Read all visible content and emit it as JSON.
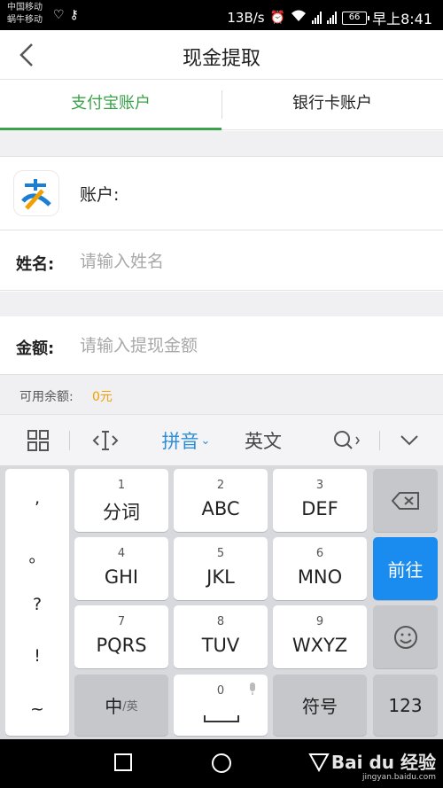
{
  "status_bar": {
    "carrier_1": "中国移动",
    "carrier_2": "蜗牛移动",
    "speed": "13B/s",
    "battery": "66",
    "time": "早上8:41"
  },
  "header": {
    "title": "现金提取"
  },
  "tabs": [
    {
      "label": "支付宝账户",
      "active": true
    },
    {
      "label": "银行卡账户",
      "active": false
    }
  ],
  "account": {
    "label": "账户:",
    "value": ""
  },
  "form": {
    "name_label": "姓名:",
    "name_placeholder": "请输入姓名",
    "amount_label": "金额:",
    "amount_placeholder": "请输入提现金额"
  },
  "balance": {
    "label": "可用余额:",
    "value": "0元"
  },
  "keyboard_toolbar": {
    "pinyin_label": "拼音",
    "english_label": "英文"
  },
  "keyboard": {
    "punctuation": [
      ",",
      "。",
      "?",
      "!",
      "~"
    ],
    "keys": [
      {
        "num": "1",
        "label": "分词"
      },
      {
        "num": "2",
        "label": "ABC"
      },
      {
        "num": "3",
        "label": "DEF"
      },
      {
        "num": "4",
        "label": "GHI"
      },
      {
        "num": "5",
        "label": "JKL"
      },
      {
        "num": "6",
        "label": "MNO"
      },
      {
        "num": "7",
        "label": "PQRS"
      },
      {
        "num": "8",
        "label": "TUV"
      },
      {
        "num": "9",
        "label": "WXYZ"
      }
    ],
    "go_label": "前往",
    "lang_label": "中",
    "lang_sub": "/英",
    "space_num": "0",
    "symbol_label": "符号",
    "num_label": "123"
  },
  "watermark": {
    "main": "Bai du 经验",
    "sub": "jingyan.baidu.com"
  },
  "colors": {
    "accent_green": "#39a34a",
    "ime_blue": "#2b8fd8",
    "go_key_blue": "#1a8cf0",
    "balance_orange": "#f0a000"
  }
}
